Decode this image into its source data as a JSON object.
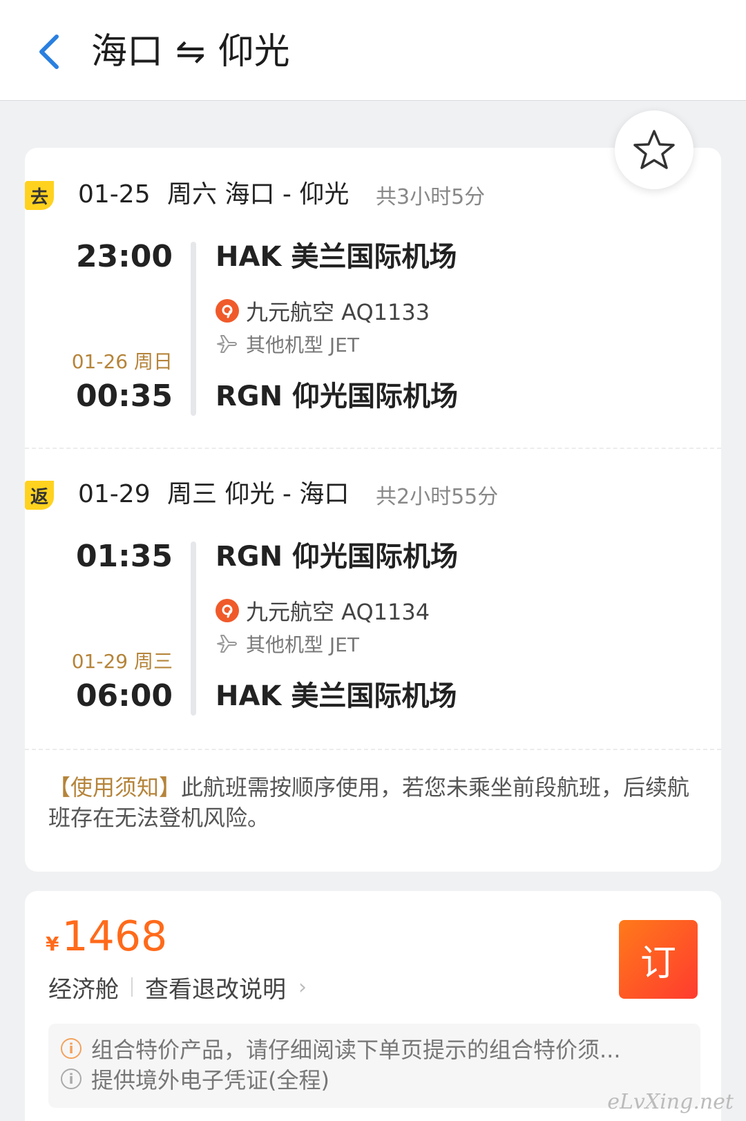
{
  "header": {
    "title_from": "海口",
    "title_swap": "⇋",
    "title_to": "仰光"
  },
  "outbound": {
    "badge": "去",
    "date": "01-25",
    "route": "周六 海口 - 仰光",
    "duration": "共3小时5分",
    "dep_time": "23:00",
    "dep_airport": "HAK 美兰国际机场",
    "airline": "九元航空 AQ1133",
    "aircraft": "其他机型 JET",
    "arr_date": "01-26 周日",
    "arr_time": "00:35",
    "arr_airport": "RGN 仰光国际机场"
  },
  "return": {
    "badge": "返",
    "date": "01-29",
    "route": "周三 仰光 - 海口",
    "duration": "共2小时55分",
    "dep_time": "01:35",
    "dep_airport": "RGN 仰光国际机场",
    "airline": "九元航空 AQ1134",
    "aircraft": "其他机型 JET",
    "arr_date": "01-29 周三",
    "arr_time": "06:00",
    "arr_airport": "HAK 美兰国际机场"
  },
  "notice": {
    "tag": "【使用须知】",
    "text": "此航班需按顺序使用，若您未乘坐前段航班，后续航班存在无法登机风险。"
  },
  "price": {
    "currency": "¥",
    "amount": "1468",
    "cabin": "经济舱",
    "refund_link": "查看退改说明",
    "book_label": "订"
  },
  "tips": [
    "组合特价产品，请仔细阅读下单页提示的组合特价须...",
    "提供境外电子凭证(全程)"
  ],
  "watermark": "eLvXing.net",
  "colors": {
    "accent_blue": "#2a7fe0",
    "price_orange": "#ff6a1a",
    "badge_yellow": "#ffd21f",
    "gold_text": "#b5843a"
  }
}
